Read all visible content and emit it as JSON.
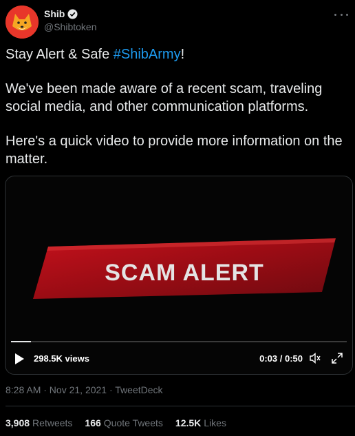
{
  "author": {
    "name": "Shib",
    "handle": "@Shibtoken"
  },
  "tweet": {
    "line1_prefix": "Stay Alert & Safe ",
    "hashtag": "#ShibArmy",
    "line1_suffix": "!",
    "paragraph2": "We've been made aware of a recent scam, traveling social media, and other communication platforms.",
    "paragraph3": "Here's a quick video to provide more information on the matter."
  },
  "video": {
    "banner_text": "SCAM ALERT",
    "views": "298.5K views",
    "time": "0:03 / 0:50",
    "progress": 0.06
  },
  "meta": {
    "timestamp": "8:28 AM · Nov 21, 2021 · TweetDeck"
  },
  "stats": {
    "retweets_count": "3,908",
    "retweets_label": "Retweets",
    "quotes_count": "166",
    "quotes_label": "Quote Tweets",
    "likes_count": "12.5K",
    "likes_label": "Likes"
  },
  "colors": {
    "accent": "#1d9bf0",
    "banner_red": "#a50a14"
  }
}
